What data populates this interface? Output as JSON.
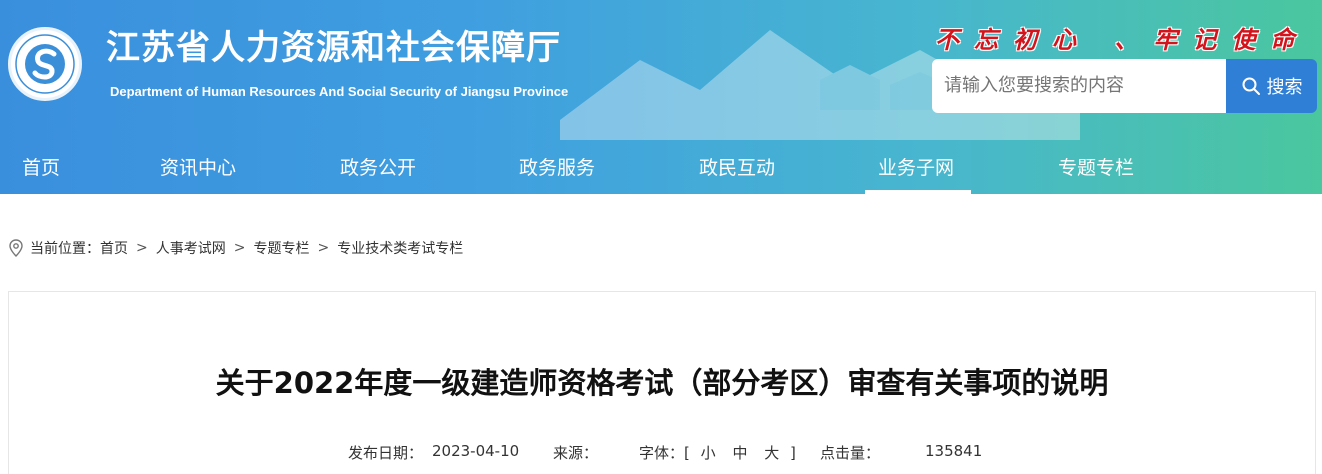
{
  "header": {
    "title": "江苏省人力资源和社会保障厅",
    "subtitle": "Department of Human Resources And Social Security of Jiangsu Province",
    "slogan": "不忘初心 、牢记使命",
    "logo_text": "江苏省人力资源和社会保障厅",
    "search": {
      "placeholder": "请输入您要搜索的内容",
      "button_label": "搜索"
    }
  },
  "nav": {
    "items": [
      {
        "label": "首页"
      },
      {
        "label": "资讯中心"
      },
      {
        "label": "政务公开"
      },
      {
        "label": "政务服务"
      },
      {
        "label": "政民互动"
      },
      {
        "label": "业务子网"
      },
      {
        "label": "专题专栏"
      }
    ],
    "active_label": "业务子网"
  },
  "breadcrumb": {
    "prefix": "当前位置：",
    "items": [
      "首页",
      "人事考试网",
      "专题专栏",
      "专业技术类考试专栏"
    ],
    "separator": ">"
  },
  "article": {
    "title": "关于2022年度一级建造师资格考试（部分考区）审查有关事项的说明",
    "date_label": "发布日期：",
    "date": "2023-04-10",
    "source_label": "来源：",
    "font_label": "字体：[",
    "font_small": "小",
    "font_medium": "中",
    "font_large": "大",
    "font_close": "]",
    "clicks_label": "点击量：",
    "clicks": "135841"
  },
  "colors": {
    "header_start": "#3a8fdd",
    "header_end": "#4ac79e",
    "search_button": "#2f7fd6",
    "slogan": "#d3141c"
  },
  "icons": {
    "search": "search-icon",
    "location": "location-pin-icon",
    "logo": "logo-icon"
  }
}
